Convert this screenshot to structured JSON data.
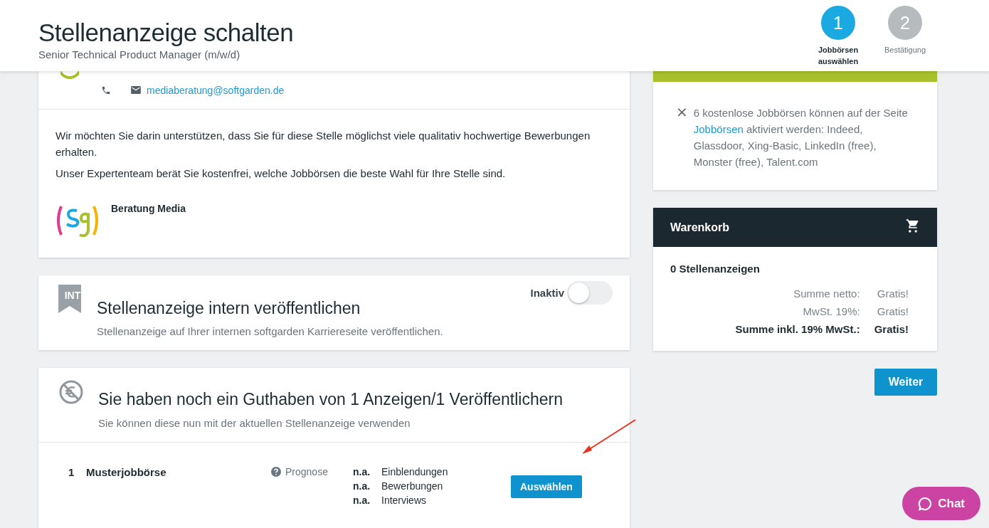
{
  "header": {
    "title": "Stellenanzeige schalten",
    "subtitle": "Senior Technical Product Manager (m/w/d)",
    "steps": [
      {
        "number": "1",
        "label": "Jobbörsen auswählen",
        "selected": true
      },
      {
        "number": "2",
        "label": "Bestätigung",
        "selected": false
      }
    ]
  },
  "consulting": {
    "email": "mediaberatung@softgarden.de",
    "paragraphs": [
      "Wir möchten Sie darin unterstützen, dass Sie für diese Stelle möglichst viele qualitativ hochwertige Bewerbungen erhalten.",
      "Unser Expertenteam berät Sie kostenfrei, welche Jobbörsen die beste Wahl für Ihre Stelle sind."
    ],
    "contact_name": "Beratung Media"
  },
  "internal": {
    "badge": "INT",
    "title": "Stellenanzeige intern veröffentlichen",
    "description": "Stellenanzeige auf Ihrer internen softgarden Karriereseite veröffentlichen.",
    "toggle_label": "Inaktiv",
    "on": false
  },
  "credit": {
    "title": "Sie haben noch ein Guthaben von 1 Anzeigen/1 Veröffentlichern",
    "subtitle": "Sie können diese nun mit der aktuellen Stellenanzeige verwenden",
    "rows": [
      {
        "index": "1",
        "name": "Musterjobbörse",
        "forecast_label": "Prognose",
        "stats": [
          {
            "value": "n.a.",
            "label": "Einblendungen"
          },
          {
            "value": "n.a.",
            "label": "Bewerbungen"
          },
          {
            "value": "n.a.",
            "label": "Interviews"
          }
        ],
        "button": "Auswählen"
      }
    ]
  },
  "notice": {
    "close": "×",
    "text_before": "6 kostenlose Jobbörsen können auf der Seite",
    "link": "Jobbörsen",
    "text_after": "aktiviert werden: Indeed, Glassdoor, Xing-Basic, LinkedIn (free), Monster (free), Talent.com"
  },
  "cart": {
    "title": "Warenkorb",
    "count": "0 Stellenanzeigen",
    "lines": [
      {
        "label": "Summe netto:",
        "value": "Gratis!",
        "kind": "normal"
      },
      {
        "label": "MwSt. 19%:",
        "value": "Gratis!",
        "kind": "normal"
      },
      {
        "label": "Summe inkl. 19% MwSt.:",
        "value": "Gratis!",
        "kind": "total"
      }
    ]
  },
  "next_button": "Weiter",
  "chat_button": "Chat"
}
